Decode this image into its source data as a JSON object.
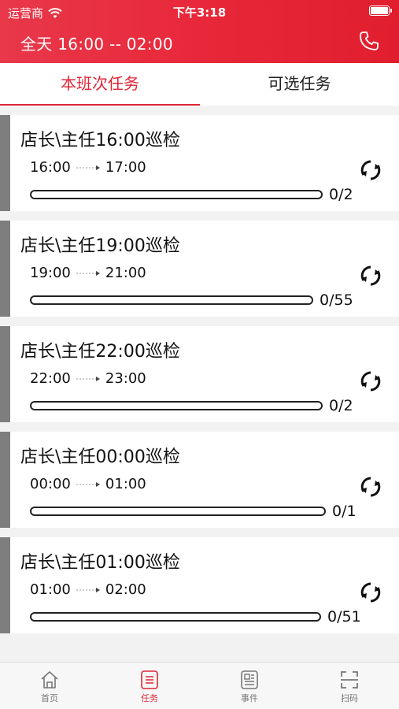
{
  "status_bar": {
    "carrier": "运营商",
    "time": "下午3:18"
  },
  "header": {
    "title": "全天 16:00 -- 02:00",
    "phone_icon": "phone-icon"
  },
  "tabs": [
    {
      "label": "本班次任务",
      "active": true
    },
    {
      "label": "可选任务",
      "active": false
    }
  ],
  "tasks": [
    {
      "title": "店长\\主任16:00巡检",
      "start": "16:00",
      "end": "17:00",
      "progress": "0/2",
      "done": 0,
      "total": 2
    },
    {
      "title": "店长\\主任19:00巡检",
      "start": "19:00",
      "end": "21:00",
      "progress": "0/55",
      "done": 0,
      "total": 55
    },
    {
      "title": "店长\\主任22:00巡检",
      "start": "22:00",
      "end": "23:00",
      "progress": "0/2",
      "done": 0,
      "total": 2
    },
    {
      "title": "店长\\主任00:00巡检",
      "start": "00:00",
      "end": "01:00",
      "progress": "0/1",
      "done": 0,
      "total": 1
    },
    {
      "title": "店长\\主任01:00巡检",
      "start": "01:00",
      "end": "02:00",
      "progress": "0/51",
      "done": 0,
      "total": 51
    }
  ],
  "tabbar": [
    {
      "label": "首页",
      "icon": "home-icon",
      "active": false
    },
    {
      "label": "任务",
      "icon": "task-list-icon",
      "active": true
    },
    {
      "label": "事件",
      "icon": "news-icon",
      "active": false
    },
    {
      "label": "扫码",
      "icon": "scan-icon",
      "active": false
    }
  ],
  "colors": {
    "brand_red": "#e02536",
    "card_stripe": "#7e7e7e"
  }
}
